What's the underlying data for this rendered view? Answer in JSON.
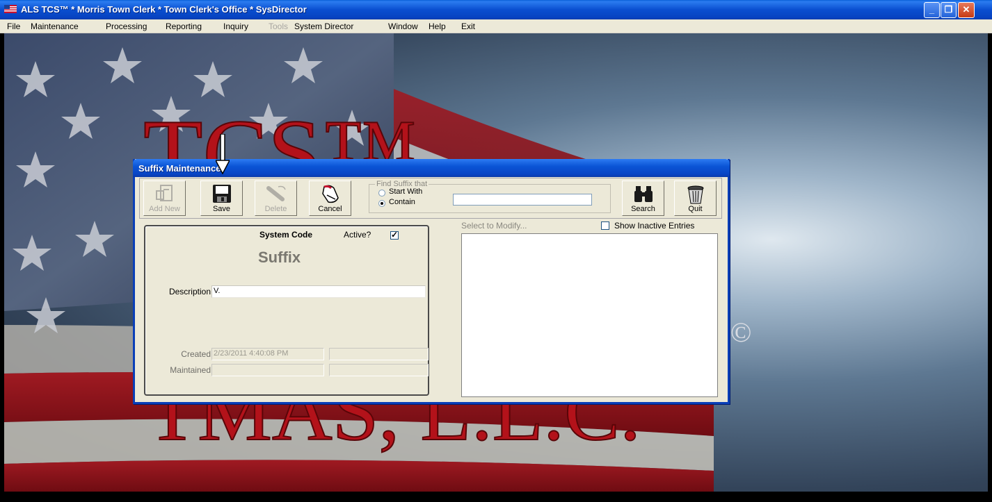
{
  "app": {
    "title": "ALS TCS™ * Morris Town Clerk * Town Clerk's Office * SysDirector",
    "window_buttons": [
      "minimize",
      "restore",
      "close"
    ]
  },
  "menu": {
    "items": [
      {
        "label": "File",
        "enabled": true
      },
      {
        "label": "Maintenance",
        "enabled": true
      },
      {
        "label": "Processing",
        "enabled": true
      },
      {
        "label": "Reporting",
        "enabled": true
      },
      {
        "label": "Inquiry",
        "enabled": true
      },
      {
        "label": "Tools",
        "enabled": false
      },
      {
        "label": "System Director",
        "enabled": true
      },
      {
        "label": "Window",
        "enabled": true
      },
      {
        "label": "Help",
        "enabled": true
      },
      {
        "label": "Exit",
        "enabled": true
      }
    ]
  },
  "background": {
    "logo_text_top": "TCS™",
    "logo_text_bottom": "TMAS, L.L.C.",
    "copyright": "©"
  },
  "dialog": {
    "title": "Suffix Maintenance",
    "toolbar": {
      "add_new": "Add New",
      "save": "Save",
      "delete": "Delete",
      "cancel": "Cancel",
      "search": "Search",
      "quit": "Quit"
    },
    "find": {
      "legend": "Find Suffix that",
      "start_with": "Start With",
      "contain": "Contain",
      "selected": "contain",
      "value": ""
    },
    "form": {
      "system_code_label": "System Code",
      "active_label": "Active?",
      "active_checked": true,
      "heading": "Suffix",
      "description_label": "Description",
      "description_value": "V.",
      "created_label": "Created",
      "created_value": "2/23/2011 4:40:08 PM",
      "created_by": "",
      "maintained_label": "Maintained",
      "maintained_value": "",
      "maintained_by": ""
    },
    "list": {
      "select_label": "Select to Modify...",
      "show_inactive_label": "Show Inactive Entries",
      "show_inactive_checked": false,
      "items": []
    }
  },
  "colors": {
    "title_bar": "#0a4fd0",
    "dialog_face": "#ece9d8",
    "logo_red": "#b3121a"
  }
}
